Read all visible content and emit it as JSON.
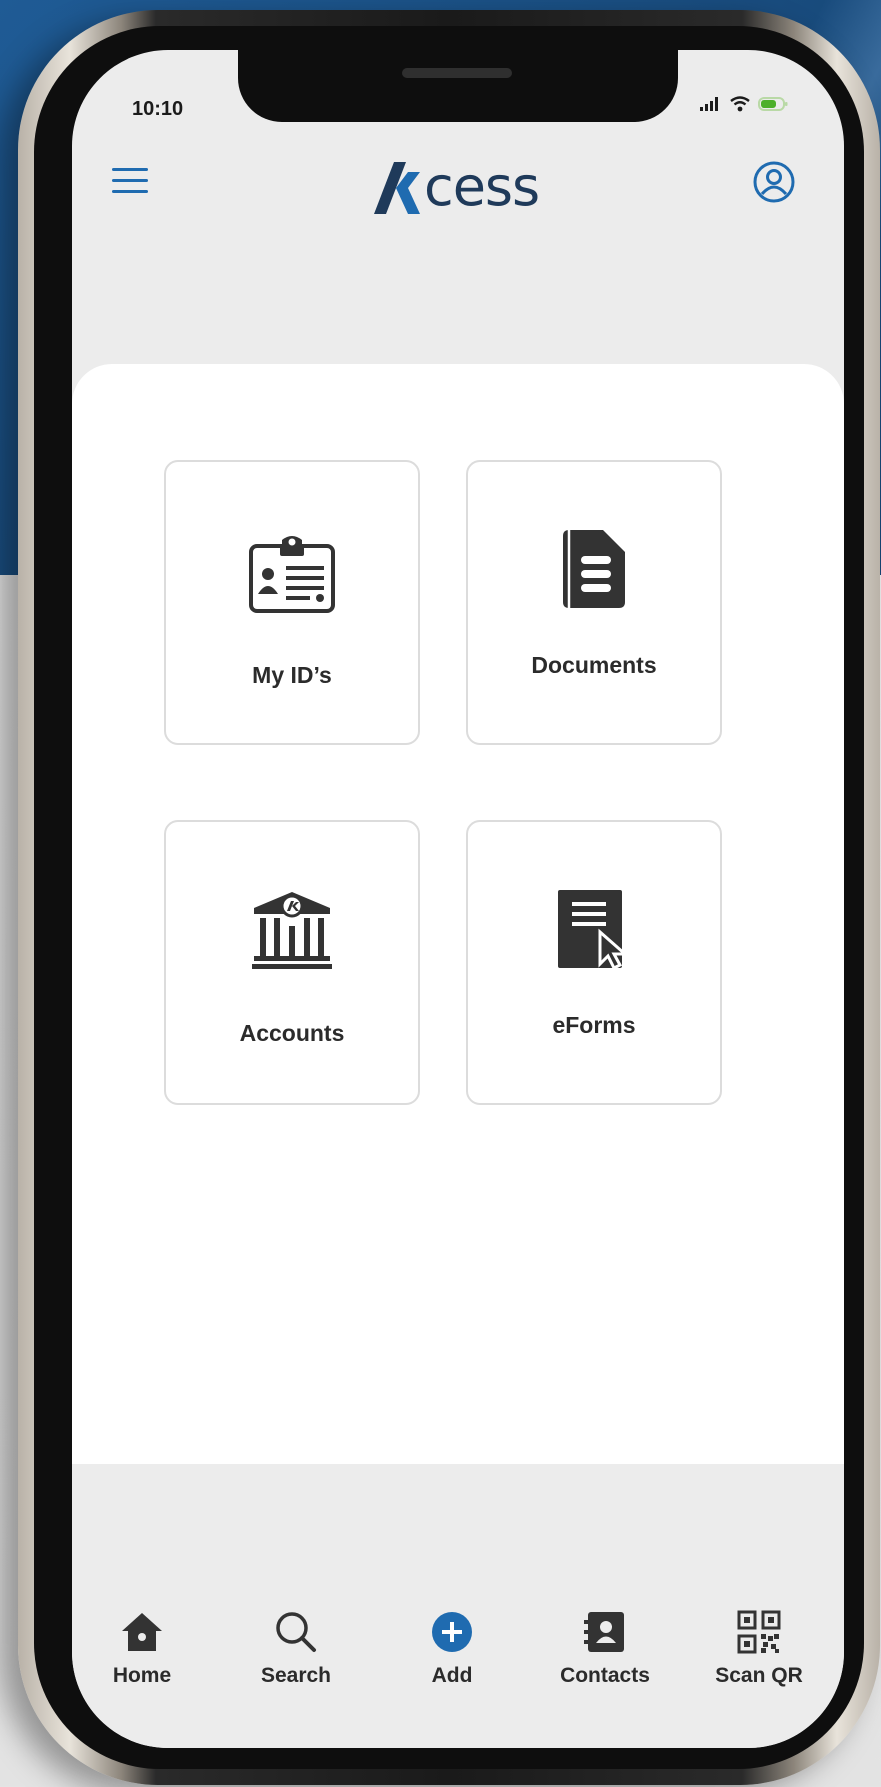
{
  "status_bar": {
    "time": "10:10"
  },
  "header": {
    "logo_text": "cess"
  },
  "tiles": [
    {
      "label": "My ID’s",
      "icon": "id-card-icon"
    },
    {
      "label": "Documents",
      "icon": "document-icon"
    },
    {
      "label": "Accounts",
      "icon": "bank-icon"
    },
    {
      "label": "eForms",
      "icon": "eform-icon"
    }
  ],
  "bottom_nav": [
    {
      "label": "Home",
      "icon": "home-icon"
    },
    {
      "label": "Search",
      "icon": "search-icon"
    },
    {
      "label": "Add",
      "icon": "add-icon"
    },
    {
      "label": "Contacts",
      "icon": "contacts-icon"
    },
    {
      "label": "Scan QR",
      "icon": "qr-code-icon"
    }
  ],
  "colors": {
    "accent": "#1f6bb0",
    "logo": "#1f3a5a",
    "battery": "#4caf2a",
    "icon_dark": "#333333"
  }
}
